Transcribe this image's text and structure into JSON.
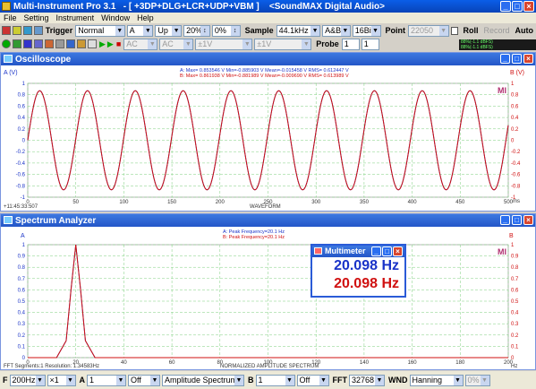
{
  "window": {
    "title": "Multi-Instrument Pro 3.1   - [ +3DP+DLG+LCR+UDP+VBM ]    <SoundMAX Digital Audio>",
    "btn_min": "_",
    "btn_max": "□",
    "btn_close": "×"
  },
  "menu": [
    "File",
    "Setting",
    "Instrument",
    "Window",
    "Help"
  ],
  "toolbar1": {
    "trigger_label": "Trigger",
    "trigger_mode": "Normal",
    "trigger_channel": "A",
    "trigger_edge": "Up",
    "trigger_level": "20%",
    "trigger_delay": "0%",
    "sample_label": "Sample",
    "sample_rate": "44.1kHz",
    "channels": "A&B",
    "bits": "16Bit",
    "point_label": "Point",
    "point_value": "22050",
    "roll_label": "Roll",
    "record_label": "Record",
    "auto_label": "Auto"
  },
  "toolbar2": {
    "ac_a": "AC",
    "ac_b": "AC",
    "range_a": "±1V",
    "range_b": "±1V",
    "probe_label": "Probe",
    "probe_a": "1",
    "probe_b": "1",
    "meter_a": "88%(-1.1 dBFS)",
    "meter_b": "88%(-1.1 dBFS)"
  },
  "oscilloscope": {
    "title": "Oscilloscope",
    "ylabel_left": "A (V)",
    "ylabel_right": "B (V)",
    "stats_a": "A: Max= 0.853546 V   Min=-0.885903 V   Mean=-0.015458 V   RMS= 0.612447 V",
    "stats_b": "B: Max= 0.861938 V   Min=-0.881989 V   Mean=-0.009690 V   RMS= 0.613989 V",
    "xlabel": "WAVEFORM",
    "xunit": "ms",
    "timestamp": "+11:45:33:507",
    "mi_logo": "MI",
    "y_ticks": [
      "1",
      "0.8",
      "0.6",
      "0.4",
      "0.2",
      "0",
      "-0.2",
      "-0.4",
      "-0.6",
      "-0.8",
      "-1"
    ],
    "x_ticks": [
      "0",
      "50",
      "100",
      "150",
      "200",
      "250",
      "300",
      "350",
      "400",
      "450",
      "500"
    ]
  },
  "spectrum": {
    "title": "Spectrum Analyzer",
    "ylabel_left": "A",
    "ylabel_right": "B",
    "peak_a": "A: Peak Frequency=20.1 Hz",
    "peak_b": "B: Peak Frequency=20.1 Hz",
    "xlabel": "NORMALIZED AMPLITUDE SPECTRUM",
    "xunit": "Hz",
    "fft_info": "FFT Segments:1     Resolution: 1.34583Hz",
    "mi_logo": "MI",
    "y_ticks": [
      "1",
      "0.9",
      "0.8",
      "0.7",
      "0.6",
      "0.5",
      "0.4",
      "0.3",
      "0.2",
      "0.1",
      "0"
    ],
    "x_ticks": [
      "0",
      "20",
      "40",
      "60",
      "80",
      "100",
      "120",
      "140",
      "160",
      "180",
      "200"
    ]
  },
  "multimeter": {
    "title": "Multimeter",
    "value_a": "20.098 Hz",
    "value_b": "20.098 Hz"
  },
  "statusbar": {
    "f_label": "F",
    "freq_range": "200Hz",
    "zoom": "×1",
    "a_label": "A",
    "a_scale": "1",
    "a_mode": "Off",
    "spectrum_type": "Amplitude Spectrum",
    "b_label": "B",
    "b_scale": "1",
    "b_mode": "Off",
    "fft_label": "FFT",
    "fft_size": "32768",
    "wnd_label": "WND",
    "window_fn": "Hanning",
    "overlap": "0%"
  },
  "colors": {
    "channel_a": "#1a33c8",
    "channel_b": "#d01010",
    "grid": "#7ecf7e",
    "title_bar": "#0a5ee8"
  },
  "chart_data": [
    {
      "type": "line",
      "name": "oscilloscope",
      "xlabel": "WAVEFORM",
      "x_unit": "ms",
      "xlim": [
        0,
        500
      ],
      "ylim": [
        -1,
        1
      ],
      "grid": true,
      "series": [
        {
          "name": "A",
          "frequency_hz": 20.098,
          "amplitude_v": 0.87,
          "color": "#1a33c8"
        },
        {
          "name": "B",
          "frequency_hz": 20.098,
          "amplitude_v": 0.87,
          "color": "#d01010"
        }
      ]
    },
    {
      "type": "line",
      "name": "spectrum",
      "xlabel": "NORMALIZED AMPLITUDE SPECTRUM",
      "x_unit": "Hz",
      "xlim": [
        0,
        200
      ],
      "ylim": [
        0,
        1
      ],
      "grid": true,
      "series": [
        {
          "name": "A",
          "x": [
            0,
            12,
            16,
            18,
            20,
            22,
            24,
            28,
            200
          ],
          "values": [
            0,
            0,
            0.15,
            0.6,
            1.0,
            0.6,
            0.15,
            0,
            0
          ],
          "color": "#1a33c8"
        },
        {
          "name": "B",
          "x": [
            0,
            12,
            16,
            18,
            20,
            22,
            24,
            28,
            200
          ],
          "values": [
            0,
            0,
            0.15,
            0.6,
            1.0,
            0.6,
            0.15,
            0,
            0
          ],
          "color": "#d01010"
        }
      ]
    }
  ]
}
